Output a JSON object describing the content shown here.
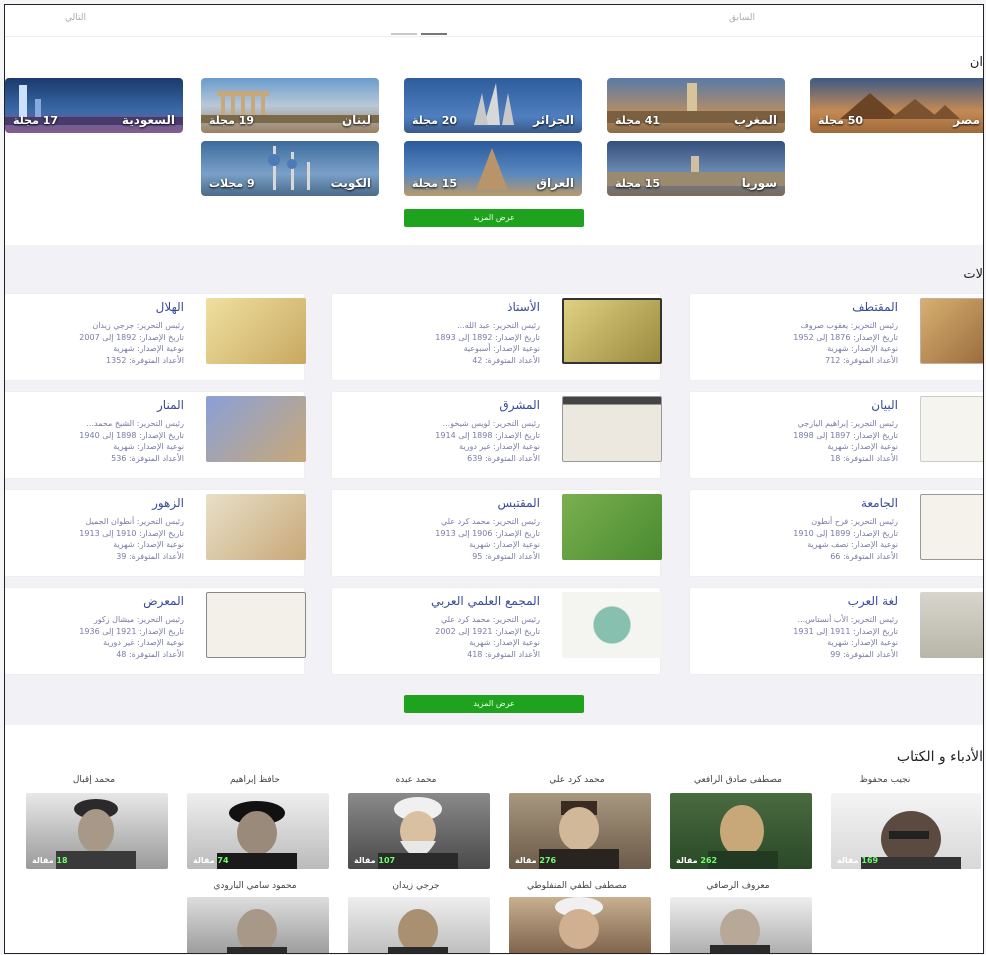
{
  "pager": {
    "prev": "السابق",
    "next": "التالي"
  },
  "countries": {
    "title": "ان",
    "more": "عرض المزيد",
    "items": [
      {
        "name": "مصر",
        "count": "50 مجلة"
      },
      {
        "name": "المغرب",
        "count": "41 مجلة"
      },
      {
        "name": "الجزائر",
        "count": "20 مجلة"
      },
      {
        "name": "لبنان",
        "count": "19 مجلة"
      },
      {
        "name": "السعودية",
        "count": "17 مجلة"
      },
      {
        "name": "سوريا",
        "count": "15 مجلة"
      },
      {
        "name": "العراق",
        "count": "15 مجلة"
      },
      {
        "name": "الكويت",
        "count": "9 مجلات"
      }
    ]
  },
  "magazines": {
    "title": "لات",
    "more": "عرض المزيد",
    "items": [
      {
        "title": "المقتطف",
        "editor": "رئيس التحرير: يعقوب صروف",
        "date": "تاريخ الإصدار: 1876 إلى 1952",
        "type": "نوعية الإصدار: شهرية",
        "issues": "الأعداد المتوفرة: 712"
      },
      {
        "title": "الأستاذ",
        "editor": "رئيس التحرير: عبد الله...",
        "date": "تاريخ الإصدار: 1892 إلى 1893",
        "type": "نوعية الإصدار: أسبوعية",
        "issues": "الأعداد المتوفرة: 42"
      },
      {
        "title": "الهلال",
        "editor": "رئيس التحرير: جرجي زيدان",
        "date": "تاريخ الإصدار: 1892 إلى 2007",
        "type": "نوعية الإصدار: شهرية",
        "issues": "الأعداد المتوفرة: 1352"
      },
      {
        "title": "البيان",
        "editor": "رئيس التحرير: إبراهيم اليازجي",
        "date": "تاريخ الإصدار: 1897 إلى 1898",
        "type": "نوعية الإصدار: شهرية",
        "issues": "الأعداد المتوفرة: 18"
      },
      {
        "title": "المشرق",
        "editor": "رئيس التحرير: لويس شيخو...",
        "date": "تاريخ الإصدار: 1898 إلى 1914",
        "type": "نوعية الإصدار: غير دورية",
        "issues": "الأعداد المتوفرة: 639"
      },
      {
        "title": "المنار",
        "editor": "رئيس التحرير: الشيخ محمد...",
        "date": "تاريخ الإصدار: 1898 إلى 1940",
        "type": "نوعية الإصدار: شهرية",
        "issues": "الأعداد المتوفرة: 536"
      },
      {
        "title": "الجامعة",
        "editor": "رئيس التحرير: فرح أنطون",
        "date": "تاريخ الإصدار: 1899 إلى 1910",
        "type": "نوعية الإصدار: نصف شهرية",
        "issues": "الأعداد المتوفرة: 66"
      },
      {
        "title": "المقتبس",
        "editor": "رئيس التحرير: محمد كرد علي",
        "date": "تاريخ الإصدار: 1906 إلى 1913",
        "type": "نوعية الإصدار: شهرية",
        "issues": "الأعداد المتوفرة: 95"
      },
      {
        "title": "الزهور",
        "editor": "رئيس التحرير: أنطوان الجميل",
        "date": "تاريخ الإصدار: 1910 إلى 1913",
        "type": "نوعية الإصدار: شهرية",
        "issues": "الأعداد المتوفرة: 39"
      },
      {
        "title": "لغة العرب",
        "editor": "رئيس التحرير: الأب أنستاس...",
        "date": "تاريخ الإصدار: 1911 إلى 1931",
        "type": "نوعية الإصدار: شهرية",
        "issues": "الأعداد المتوفرة: 99"
      },
      {
        "title": "المجمع العلمي العربي",
        "editor": "رئيس التحرير: محمد كرد علي",
        "date": "تاريخ الإصدار: 1921 إلى 2002",
        "type": "نوعية الإصدار: شهرية",
        "issues": "الأعداد المتوفرة: 418"
      },
      {
        "title": "المعرض",
        "editor": "رئيس التحرير: ميشال زكور",
        "date": "تاريخ الإصدار: 1921 إلى 1936",
        "type": "نوعية الإصدار: غير دورية",
        "issues": "الأعداد المتوفرة: 48"
      }
    ]
  },
  "writers": {
    "title": "الأدباء و الكتاب",
    "items": [
      {
        "name": "نجيب محفوظ",
        "num": "169",
        "unit": "مقالة"
      },
      {
        "name": "مصطفى صادق الرافعي",
        "num": "262",
        "unit": "مقالة"
      },
      {
        "name": "محمد كرد علي",
        "num": "276",
        "unit": "مقالة"
      },
      {
        "name": "محمد عبده",
        "num": "107",
        "unit": "مقالة"
      },
      {
        "name": "حافظ إبراهيم",
        "num": "74",
        "unit": "مقالة"
      },
      {
        "name": "محمد إقبال",
        "num": "18",
        "unit": "مقالة"
      },
      {
        "name": "معروف الرصافي"
      },
      {
        "name": "مصطفى لطفي المنفلوطي"
      },
      {
        "name": "جرجي زيدان"
      },
      {
        "name": "محمود سامي البارودي"
      }
    ]
  }
}
